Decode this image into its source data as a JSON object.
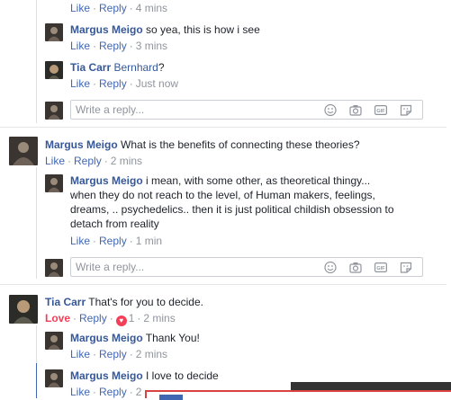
{
  "comments": [
    {
      "id": "c0",
      "actions": {
        "like": "Like",
        "reply": "Reply",
        "time": "4 mins"
      }
    },
    {
      "id": "c1",
      "author": "Margus Meigo",
      "text": "so yea, this is how i see",
      "actions": {
        "like": "Like",
        "reply": "Reply",
        "time": "3 mins"
      }
    },
    {
      "id": "c2",
      "author": "Tia Carr",
      "mention": "Bernhard",
      "text": "?",
      "actions": {
        "like": "Like",
        "reply": "Reply",
        "time": "Just now"
      }
    },
    {
      "id": "c3",
      "author": "Margus Meigo",
      "text": "What is the benefits of connecting these theories?",
      "actions": {
        "like": "Like",
        "reply": "Reply",
        "time": "2 mins"
      }
    },
    {
      "id": "c4",
      "author": "Margus Meigo",
      "lines": [
        "i mean, with some other, as theoretical thingy...",
        "when they do not reach to the level, of Human makers, feelings,",
        "dreams, .. psychedelics.. then it is just political childish obsession to",
        "detach from reality"
      ],
      "actions": {
        "like": "Like",
        "reply": "Reply",
        "time": "1 min"
      }
    },
    {
      "id": "c5",
      "author": "Tia Carr",
      "text": "That's for you to decide.",
      "actions": {
        "like": "Love",
        "reply": "Reply",
        "reaction_count": "1",
        "time": "2 mins"
      }
    },
    {
      "id": "c6",
      "author": "Margus Meigo",
      "text": "Thank You!",
      "actions": {
        "like": "Like",
        "reply": "Reply",
        "time": "2 mins"
      }
    },
    {
      "id": "c7",
      "author": "Margus Meigo",
      "text": "I love to decide",
      "actions": {
        "like": "Like",
        "reply": "Reply",
        "time": "2"
      }
    }
  ],
  "reply_box": {
    "placeholder": "Write a reply...",
    "icons": [
      "emoji-icon",
      "camera-icon",
      "gif-icon",
      "sticker-icon"
    ]
  },
  "colors": {
    "link": "#365899",
    "action": "#4267b2",
    "love": "#f33e58",
    "muted": "#90949c"
  }
}
